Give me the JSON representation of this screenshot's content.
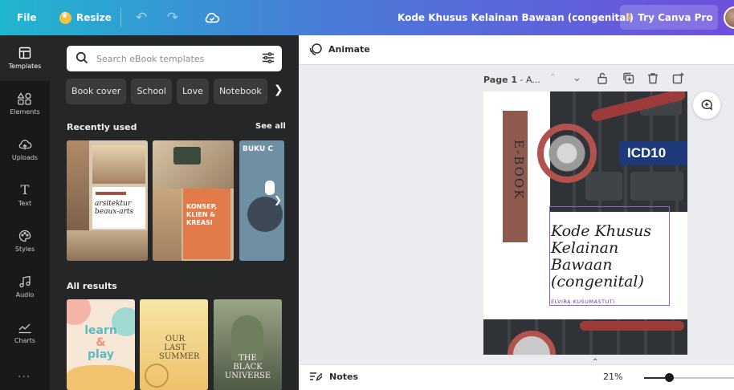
{
  "topbar": {
    "file_label": "File",
    "resize_label": "Resize",
    "document_title": "Kode Khusus Kelainan Bawaan (congenital)",
    "try_pro_label": "Try Canva Pro",
    "gradient_colors": [
      "#1fb6cf",
      "#4a7bd8",
      "#6e4fdc"
    ]
  },
  "rail": {
    "items": [
      {
        "label": "Templates",
        "icon": "templates-icon"
      },
      {
        "label": "Elements",
        "icon": "elements-icon"
      },
      {
        "label": "Uploads",
        "icon": "upload-cloud-icon"
      },
      {
        "label": "Text",
        "icon": "text-icon"
      },
      {
        "label": "Styles",
        "icon": "palette-icon"
      },
      {
        "label": "Audio",
        "icon": "music-note-icon"
      },
      {
        "label": "Charts",
        "icon": "chart-icon"
      }
    ],
    "more": "···"
  },
  "panel": {
    "search_placeholder": "Search eBook templates",
    "chips": [
      "Book cover",
      "School",
      "Love",
      "Notebook"
    ],
    "recently_used": "Recently used",
    "see_all": "See all",
    "all_results": "All results",
    "recent_thumbs": [
      {
        "lines": [
          "arsitektur",
          "beaux-arts"
        ]
      },
      {
        "lines": [
          "KONSEP,",
          "KLIEN &",
          "KREASI"
        ]
      },
      {
        "lines": [
          "BUKU C"
        ]
      }
    ],
    "result_thumbs": [
      {
        "lines": [
          "learn",
          "&",
          "play"
        ]
      },
      {
        "lines": [
          "OUR",
          "LAST",
          "SUMMER"
        ]
      },
      {
        "lines": [
          "THE",
          "BLACK",
          "UNIVERSE"
        ]
      }
    ]
  },
  "editor": {
    "animate_label": "Animate",
    "page_label_bold": "Page 1",
    "page_label_rest": " - A...",
    "page1": {
      "vertical_text": "E-BOOK",
      "badge": "ICD10",
      "title": "Kode Khusus Kelainan Bawaan (congenital)",
      "author": "ELVIRA KUSUMASTUTI"
    }
  },
  "bottombar": {
    "notes_label": "Notes",
    "zoom": "21%",
    "zoom_fraction": 0.21
  }
}
